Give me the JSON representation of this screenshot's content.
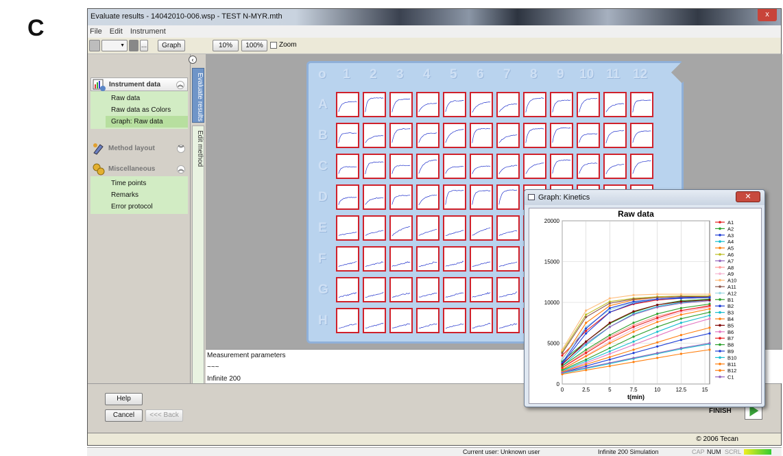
{
  "panel_letter": "C",
  "window": {
    "title": "Evaluate results - 14042010-006.wsp - TEST N-MYR.mth",
    "close_label": "x"
  },
  "menu": [
    "File",
    "Edit",
    "Instrument"
  ],
  "toolbar": {
    "more_label": "...",
    "graph_label": "Graph",
    "zoom10_label": "10%",
    "zoom100_label": "100%",
    "zoom_checkbox_label": "Zoom"
  },
  "sidebar": {
    "instrument_data": {
      "title": "Instrument data",
      "items": [
        "Raw data",
        "Raw data as Colors",
        "Graph: Raw data"
      ],
      "selected_index": 2
    },
    "method_layout": {
      "title": "Method layout"
    },
    "miscellaneous": {
      "title": "Miscellaneous",
      "items": [
        "Time points",
        "Remarks",
        "Error protocol"
      ]
    },
    "tabs": [
      "Evaluate results",
      "Edit method"
    ]
  },
  "plate": {
    "corner_label": "o",
    "columns": [
      "1",
      "2",
      "3",
      "4",
      "5",
      "6",
      "7",
      "8",
      "9",
      "10",
      "11",
      "12"
    ],
    "rows": [
      "A",
      "B",
      "C",
      "D",
      "E",
      "F",
      "G",
      "H"
    ]
  },
  "params": {
    "heading": "Measurement parameters",
    "separator": "~~~",
    "instrument": "Infinite 200"
  },
  "buttons": {
    "help": "Help",
    "cancel": "Cancel",
    "back": "<<< Back",
    "finish": "FINISH"
  },
  "copyright": "© 2006 Tecan",
  "statusbar": {
    "user": "Current user: Unknown user",
    "instrument": "Infinite 200 Simulation",
    "indicators": [
      "CAP",
      "NUM",
      "SCRL"
    ]
  },
  "colors": {
    "well_border": "#d0202a",
    "well_curve": "#2233cc",
    "sidebar_green": "#d2ecc4",
    "plate_blue": "#b9d3ee"
  },
  "chart_data": {
    "type": "line",
    "window_title": "Graph: Kinetics",
    "title": "Raw data",
    "xlabel": "t(min)",
    "ylabel": "",
    "xlim": [
      0,
      15.5
    ],
    "ylim": [
      0,
      20000
    ],
    "xticks": [
      "0",
      "2.5",
      "5",
      "7.5",
      "10",
      "12.5",
      "15"
    ],
    "yticks": [
      "0",
      "5000",
      "10000",
      "15000",
      "20000"
    ],
    "grid": true,
    "legend_position": "right",
    "legend": [
      "A1",
      "A2",
      "A3",
      "A4",
      "A5",
      "A6",
      "A7",
      "A8",
      "A9",
      "A10",
      "A11",
      "A12",
      "B1",
      "B2",
      "B3",
      "B4",
      "B5",
      "B6",
      "B7",
      "B8",
      "B9",
      "B10",
      "B11",
      "B12",
      "C1"
    ],
    "x": [
      0,
      2.5,
      5,
      7.5,
      10,
      12.5,
      15.5
    ],
    "series": [
      {
        "name": "A1",
        "color": "#e41a1c",
        "values": [
          3500,
          6500,
          8800,
          9800,
          10300,
          10500,
          10600
        ]
      },
      {
        "name": "A2",
        "color": "#2ca02c",
        "values": [
          2800,
          5200,
          7400,
          8800,
          9700,
          10200,
          10400
        ]
      },
      {
        "name": "A3",
        "color": "#1f3fd6",
        "values": [
          2500,
          6200,
          8800,
          9900,
          10400,
          10600,
          10700
        ]
      },
      {
        "name": "A4",
        "color": "#17becf",
        "values": [
          2200,
          4800,
          7000,
          8600,
          9500,
          10000,
          10300
        ]
      },
      {
        "name": "A5",
        "color": "#ff7f0e",
        "values": [
          3000,
          7500,
          9600,
          10300,
          10600,
          10700,
          10800
        ]
      },
      {
        "name": "A6",
        "color": "#bcbd22",
        "values": [
          4000,
          8500,
          10100,
          10500,
          10700,
          10800,
          10800
        ]
      },
      {
        "name": "A7",
        "color": "#9467bd",
        "values": [
          2500,
          5000,
          7000,
          8500,
          9400,
          9900,
          10200
        ]
      },
      {
        "name": "A8",
        "color": "#ff9896",
        "values": [
          2000,
          4000,
          5800,
          7200,
          8300,
          9000,
          9500
        ]
      },
      {
        "name": "A9",
        "color": "#f7b6d2",
        "values": [
          1800,
          3500,
          5200,
          6700,
          7900,
          8800,
          9400
        ]
      },
      {
        "name": "A10",
        "color": "#ffbb78",
        "values": [
          4200,
          9000,
          10500,
          10900,
          11000,
          11000,
          11000
        ]
      },
      {
        "name": "A11",
        "color": "#8c564b",
        "values": [
          3800,
          8200,
          9900,
          10400,
          10600,
          10700,
          10700
        ]
      },
      {
        "name": "A12",
        "color": "#9edae5",
        "values": [
          3000,
          7000,
          9100,
          10000,
          10400,
          10500,
          10600
        ]
      },
      {
        "name": "B1",
        "color": "#2ca02c",
        "values": [
          2200,
          4200,
          6000,
          7500,
          8600,
          9300,
          9800
        ]
      },
      {
        "name": "B2",
        "color": "#1f3fd6",
        "values": [
          2600,
          6800,
          9300,
          10100,
          10400,
          10500,
          10600
        ]
      },
      {
        "name": "B3",
        "color": "#17becf",
        "values": [
          1600,
          2800,
          4000,
          5200,
          6400,
          7500,
          8400
        ]
      },
      {
        "name": "B4",
        "color": "#ff7f0e",
        "values": [
          1800,
          3400,
          5000,
          6400,
          7600,
          8500,
          9200
        ]
      },
      {
        "name": "B5",
        "color": "#7f0000",
        "values": [
          2400,
          5200,
          7500,
          8900,
          9700,
          10100,
          10300
        ]
      },
      {
        "name": "B6",
        "color": "#e377c2",
        "values": [
          1500,
          2600,
          3700,
          4800,
          5900,
          7000,
          8000
        ]
      },
      {
        "name": "B7",
        "color": "#e41a1c",
        "values": [
          2000,
          3800,
          5600,
          7000,
          8100,
          9000,
          9600
        ]
      },
      {
        "name": "B8",
        "color": "#2ca02c",
        "values": [
          1700,
          3000,
          4400,
          5800,
          7000,
          8000,
          8800
        ]
      },
      {
        "name": "B9",
        "color": "#1f3fd6",
        "values": [
          1400,
          2200,
          3000,
          3800,
          4600,
          5400,
          6200
        ]
      },
      {
        "name": "B10",
        "color": "#17becf",
        "values": [
          1300,
          1900,
          2500,
          3100,
          3700,
          4300,
          4900
        ]
      },
      {
        "name": "B11",
        "color": "#ff7f0e",
        "values": [
          1500,
          2400,
          3300,
          4200,
          5100,
          6000,
          6900
        ]
      },
      {
        "name": "B12",
        "color": "#ff7f0e",
        "values": [
          1200,
          1700,
          2200,
          2700,
          3200,
          3700,
          4200
        ]
      },
      {
        "name": "C1",
        "color": "#9467bd",
        "values": [
          1400,
          2000,
          2600,
          3200,
          3800,
          4400,
          5000
        ]
      }
    ]
  }
}
